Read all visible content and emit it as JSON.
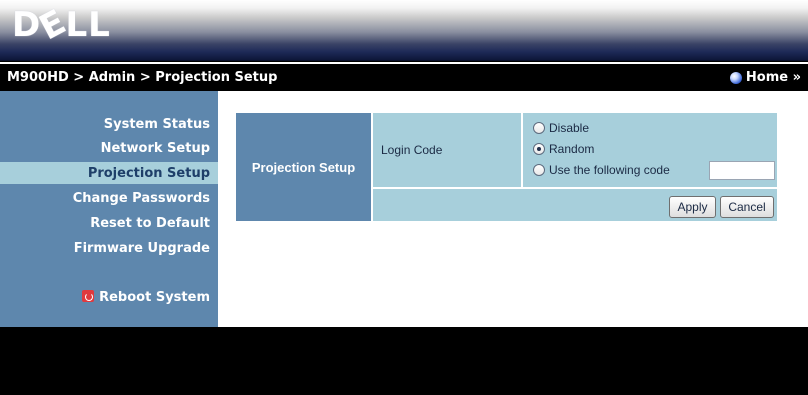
{
  "header": {
    "logo_prefix": "D",
    "logo_e": "E",
    "logo_suffix": "LL"
  },
  "nav": {
    "breadcrumb": "M900HD > Admin > Projection Setup",
    "home_label": "Home »"
  },
  "sidebar": {
    "items": [
      {
        "label": "System Status"
      },
      {
        "label": "Network Setup"
      },
      {
        "label": "Projection Setup"
      },
      {
        "label": "Change Passwords"
      },
      {
        "label": "Reset to Default"
      },
      {
        "label": "Firmware Upgrade"
      }
    ],
    "reboot_label": "Reboot System",
    "active_item": "Projection Setup"
  },
  "main": {
    "section_title": "Projection Setup",
    "field_label": "Login Code",
    "options": [
      {
        "label": "Disable",
        "checked": false
      },
      {
        "label": "Random",
        "checked": true
      },
      {
        "label": "Use the following code",
        "checked": false
      }
    ],
    "code_value": "",
    "apply_label": "Apply",
    "cancel_label": "Cancel"
  },
  "colors": {
    "sidebar_bg": "#5e87ad",
    "panel_light": "#a7cfdb",
    "active_text": "#1e3f69"
  }
}
